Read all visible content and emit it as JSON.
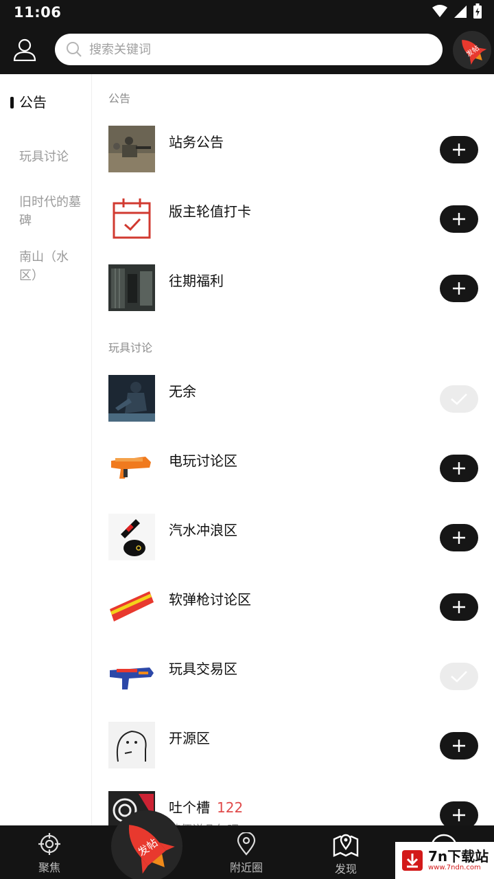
{
  "status_bar": {
    "time": "11:06"
  },
  "header": {
    "search_placeholder": "搜索关键词",
    "post_button_label": "发帖"
  },
  "sidebar": {
    "items": [
      {
        "label": "公告",
        "active": true
      },
      {
        "label": "玩具讨论",
        "active": false
      },
      {
        "label": "旧时代的墓碑",
        "active": false
      },
      {
        "label": "南山（水区）",
        "active": false
      }
    ]
  },
  "sections": [
    {
      "title": "公告",
      "items": [
        {
          "name": "站务公告",
          "status": "add"
        },
        {
          "name": "版主轮值打卡",
          "status": "add",
          "icon": "calendar-check-icon"
        },
        {
          "name": "往期福利",
          "status": "add"
        }
      ]
    },
    {
      "title": "玩具讨论",
      "items": [
        {
          "name": "无余",
          "status": "joined"
        },
        {
          "name": "电玩讨论区",
          "status": "add"
        },
        {
          "name": "汽水冲浪区",
          "status": "add"
        },
        {
          "name": "软弹枪讨论区",
          "status": "add"
        },
        {
          "name": "玩具交易区",
          "status": "joined"
        },
        {
          "name": "开源区",
          "status": "add"
        },
        {
          "name": "吐个槽",
          "count": "122",
          "subtitle": "随便说几句吧",
          "status": "add"
        }
      ]
    }
  ],
  "bottom_nav": {
    "items": [
      {
        "label": "聚焦",
        "icon": "crosshair-icon"
      },
      {
        "label": "发帖",
        "icon": "rocket-icon"
      },
      {
        "label": "附近圈",
        "icon": "location-pin-icon"
      },
      {
        "label": "发现",
        "icon": "map-icon"
      }
    ]
  },
  "watermark": {
    "text": "7n下载站",
    "url": "www.7ndn.com"
  },
  "colors": {
    "header_bg": "#141414",
    "accent_red": "#e04a4a",
    "rocket_red": "#e8392e"
  }
}
